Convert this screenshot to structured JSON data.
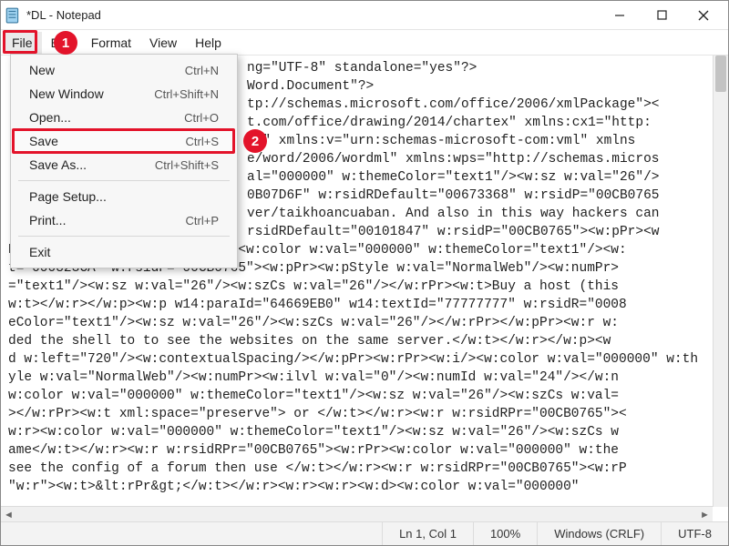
{
  "window": {
    "title": "*DL - Notepad"
  },
  "menubar": {
    "file": "File",
    "edit": "Edit",
    "format": "Format",
    "view": "View",
    "help": "Help"
  },
  "callouts": {
    "one": "1",
    "two": "2"
  },
  "file_menu": {
    "new": {
      "label": "New",
      "shortcut": "Ctrl+N"
    },
    "new_window": {
      "label": "New Window",
      "shortcut": "Ctrl+Shift+N"
    },
    "open": {
      "label": "Open...",
      "shortcut": "Ctrl+O"
    },
    "save": {
      "label": "Save",
      "shortcut": "Ctrl+S"
    },
    "save_as": {
      "label": "Save As...",
      "shortcut": "Ctrl+Shift+S"
    },
    "page_setup": {
      "label": "Page Setup...",
      "shortcut": ""
    },
    "print": {
      "label": "Print...",
      "shortcut": "Ctrl+P"
    },
    "exit": {
      "label": "Exit",
      "shortcut": ""
    }
  },
  "editor_lines": [
    "ng=\"UTF-8\" standalone=\"yes\"?>",
    "Word.Document\"?>",
    "tp://schemas.microsoft.com/office/2006/xmlPackage\"><",
    "t.com/office/drawing/2014/chartex\" xmlns:cx1=\"http:",
    "ch\" xmlns:v=\"urn:schemas-microsoft-com:vml\" xmlns",
    "e/word/2006/wordml\" xmlns:wps=\"http://schemas.micros",
    "al=\"000000\" w:themeColor=\"text1\"/><w:sz w:val=\"26\"/>",
    "0B07D6F\" w:rsidRDefault=\"00673368\" w:rsidP=\"00CB0765",
    "ver/taikhoancuaban. And also in this way hackers can",
    "rsidRDefault=\"00101847\" w:rsidP=\"00CB0765\"><w:pPr><w",
    "Pr></w:pPr><w:r><w:rPr><w:b/><w:color w:val=\"000000\" w:themeColor=\"text1\"/><w:",
    "t=\"000823CA\" w:rsidP=\"00CB0765\"><w:pPr><w:pStyle w:val=\"NormalWeb\"/><w:numPr>",
    "=\"text1\"/><w:sz w:val=\"26\"/><w:szCs w:val=\"26\"/></w:rPr><w:t>Buy a host (this ",
    "w:t></w:r></w:p><w:p w14:paraId=\"64669EB0\" w14:textId=\"77777777\" w:rsidR=\"0008",
    "eColor=\"text1\"/><w:sz w:val=\"26\"/><w:szCs w:val=\"26\"/></w:rPr></w:pPr><w:r w:",
    "ded the shell to to see the websites on the same server.</w:t></w:r></w:p><w",
    "d w:left=\"720\"/><w:contextualSpacing/></w:pPr><w:rPr><w:i/><w:color w:val=\"000000\" w:th",
    "yle w:val=\"NormalWeb\"/><w:numPr><w:ilvl w:val=\"0\"/><w:numId w:val=\"24\"/></w:n",
    "w:color w:val=\"000000\" w:themeColor=\"text1\"/><w:sz w:val=\"26\"/><w:szCs w:val=",
    "></w:rPr><w:t xml:space=\"preserve\"> or </w:t></w:r><w:r w:rsidRPr=\"00CB0765\"><",
    "w:r><w:color w:val=\"000000\" w:themeColor=\"text1\"/><w:sz w:val=\"26\"/><w:szCs w",
    "ame</w:t></w:r><w:r w:rsidRPr=\"00CB0765\"><w:rPr><w:color w:val=\"000000\" w:the",
    "see the config of a forum then use </w:t></w:r><w:r w:rsidRPr=\"00CB0765\"><w:rP",
    "\"w:r\"><w:t>&lt:rPr&gt;</w:t></w:r><w:r><w:r><w:d><w:color w:val=\"000000\""
  ],
  "status": {
    "ln_col": "Ln 1, Col 1",
    "zoom": "100%",
    "line_ending": "Windows (CRLF)",
    "encoding": "UTF-8"
  }
}
